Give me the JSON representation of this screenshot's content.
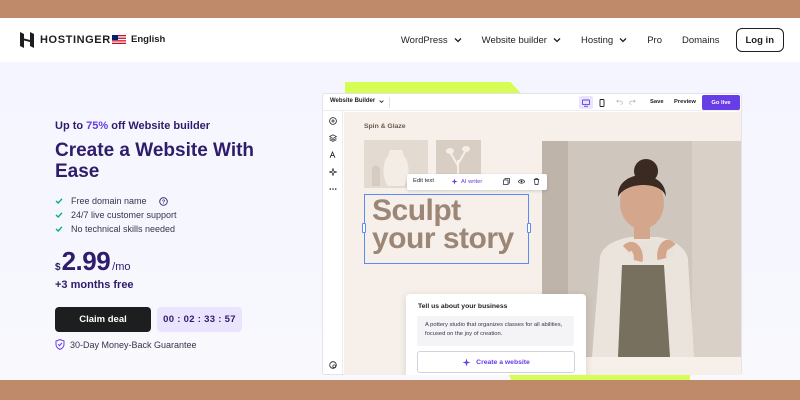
{
  "header": {
    "logo_text": "HOSTINGER",
    "language": "English",
    "nav": [
      {
        "label": "WordPress",
        "has_dropdown": true
      },
      {
        "label": "Website builder",
        "has_dropdown": true
      },
      {
        "label": "Hosting",
        "has_dropdown": true
      },
      {
        "label": "Pro",
        "has_dropdown": false
      },
      {
        "label": "Domains",
        "has_dropdown": false
      }
    ],
    "login_label": "Log in"
  },
  "hero": {
    "promo_prefix": "Up to ",
    "promo_percent": "75%",
    "promo_suffix": " off Website builder",
    "title": "Create a Website With Ease",
    "features": [
      "Free domain name",
      "24/7 live customer support",
      "No technical skills needed"
    ],
    "price_currency": "$",
    "price_amount": "2.99",
    "price_period": "/mo",
    "bonus": "+3 months free",
    "cta_label": "Claim deal",
    "timer": "00 : 02 : 33 : 57",
    "guarantee": "30-Day Money-Back Guarantee"
  },
  "builder": {
    "mode_select": "Website Builder",
    "save_label": "Save",
    "preview_label": "Preview",
    "golive_label": "Go live",
    "brand_name": "Spin & Glaze",
    "edit_text_label": "Edit text",
    "ai_writer_label": "AI writer",
    "headline_line1": "Sculpt",
    "headline_line2": "your story",
    "card_title": "Tell us about your business",
    "card_text": "A pottery studio that organizes classes for all abilities, focused on the joy of creation.",
    "card_button": "Create a website"
  },
  "colors": {
    "accent": "#673de6",
    "dark_purple": "#2f1c6a",
    "lime": "#d5fd53",
    "frame": "#be8a6a",
    "check_green": "#00b090"
  },
  "icons": [
    "logo-mark",
    "us-flag-icon",
    "chevron-down-icon",
    "check-icon",
    "help-circle-icon",
    "shield-check-icon",
    "desktop-icon",
    "mobile-icon",
    "undo-icon",
    "redo-icon",
    "plus-icon",
    "layers-icon",
    "text-style-icon",
    "sparkle-icon",
    "more-icon",
    "copy-icon",
    "eye-icon",
    "trash-icon"
  ]
}
